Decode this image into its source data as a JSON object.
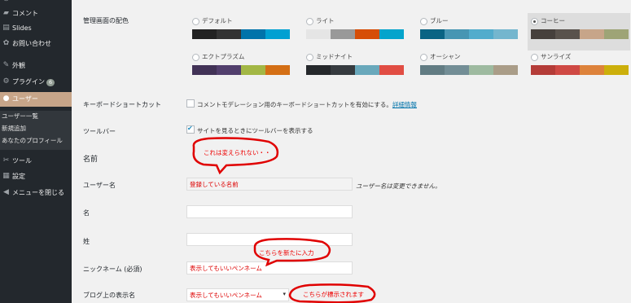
{
  "sidebar": {
    "items": [
      {
        "label": "",
        "icon": "dashboard-icon"
      },
      {
        "label": "コメント",
        "icon": "comment-icon"
      },
      {
        "label": "Slides",
        "icon": "slides-icon"
      },
      {
        "label": "お問い合わせ",
        "icon": "contact-icon"
      },
      {
        "label": "外観",
        "icon": "appearance-icon"
      },
      {
        "label": "プラグイン",
        "icon": "plugin-icon",
        "badge": "6"
      },
      {
        "label": "ユーザー",
        "icon": "user-icon"
      },
      {
        "label": "ツール",
        "icon": "tool-icon"
      },
      {
        "label": "設定",
        "icon": "settings-icon"
      },
      {
        "label": "メニューを閉じる",
        "icon": "collapse-icon"
      }
    ],
    "submenu": [
      "ユーザー一覧",
      "新規追加",
      "あなたのプロフィール"
    ]
  },
  "labels": {
    "color_scheme": "管理画面の配色",
    "keyboard": "キーボードショートカット",
    "toolbar": "ツールバー",
    "name_section": "名前",
    "username": "ユーザー名",
    "first_name": "名",
    "last_name": "姓",
    "nickname": "ニックネーム (必須)",
    "display_name": "ブログ上の表示名"
  },
  "schemes": [
    {
      "name": "デフォルト",
      "colors": [
        "#222222",
        "#333333",
        "#0073aa",
        "#00a0d2"
      ],
      "selected": false
    },
    {
      "name": "ライト",
      "colors": [
        "#e5e5e5",
        "#999999",
        "#d64e07",
        "#04a4cc"
      ],
      "selected": false
    },
    {
      "name": "ブルー",
      "colors": [
        "#096484",
        "#4796b3",
        "#52accc",
        "#74b6ce"
      ],
      "selected": false
    },
    {
      "name": "コーヒー",
      "colors": [
        "#46403c",
        "#59524c",
        "#c7a589",
        "#9ea476"
      ],
      "selected": true
    },
    {
      "name": "エクトプラズム",
      "colors": [
        "#413256",
        "#523f6d",
        "#a3b745",
        "#d46f15"
      ],
      "selected": false
    },
    {
      "name": "ミッドナイト",
      "colors": [
        "#25282b",
        "#363b3f",
        "#69a8bb",
        "#e14d43"
      ],
      "selected": false
    },
    {
      "name": "オーシャン",
      "colors": [
        "#627c83",
        "#738e96",
        "#9ebaa0",
        "#aa9d88"
      ],
      "selected": false
    },
    {
      "name": "サンライズ",
      "colors": [
        "#b43c38",
        "#cf4944",
        "#dd823b",
        "#ccaf0b"
      ],
      "selected": false
    }
  ],
  "keyboard_text": "コメントモデレーション用のキーボードショートカットを有効にする。",
  "keyboard_link": "詳細情報",
  "toolbar_text": "サイトを見るときにツールバーを表示する",
  "toolbar_checked": true,
  "fields": {
    "username_value": "登録している名前",
    "username_note": "ユーザー名は変更できません。",
    "first_name_value": "",
    "last_name_value": "",
    "nickname_value": "表示してもいいペンネーム",
    "display_name_value": "表示してもいいペンネーム"
  },
  "annotations": {
    "cannot_change": "これは変えられない・・",
    "enter_new": "こちらを新たに入力",
    "displayed": "こちらが標示されます"
  },
  "colors": {
    "sidebar_bg": "#23282d",
    "active_menu": "#c7a589",
    "annotation_red": "#e00000"
  }
}
